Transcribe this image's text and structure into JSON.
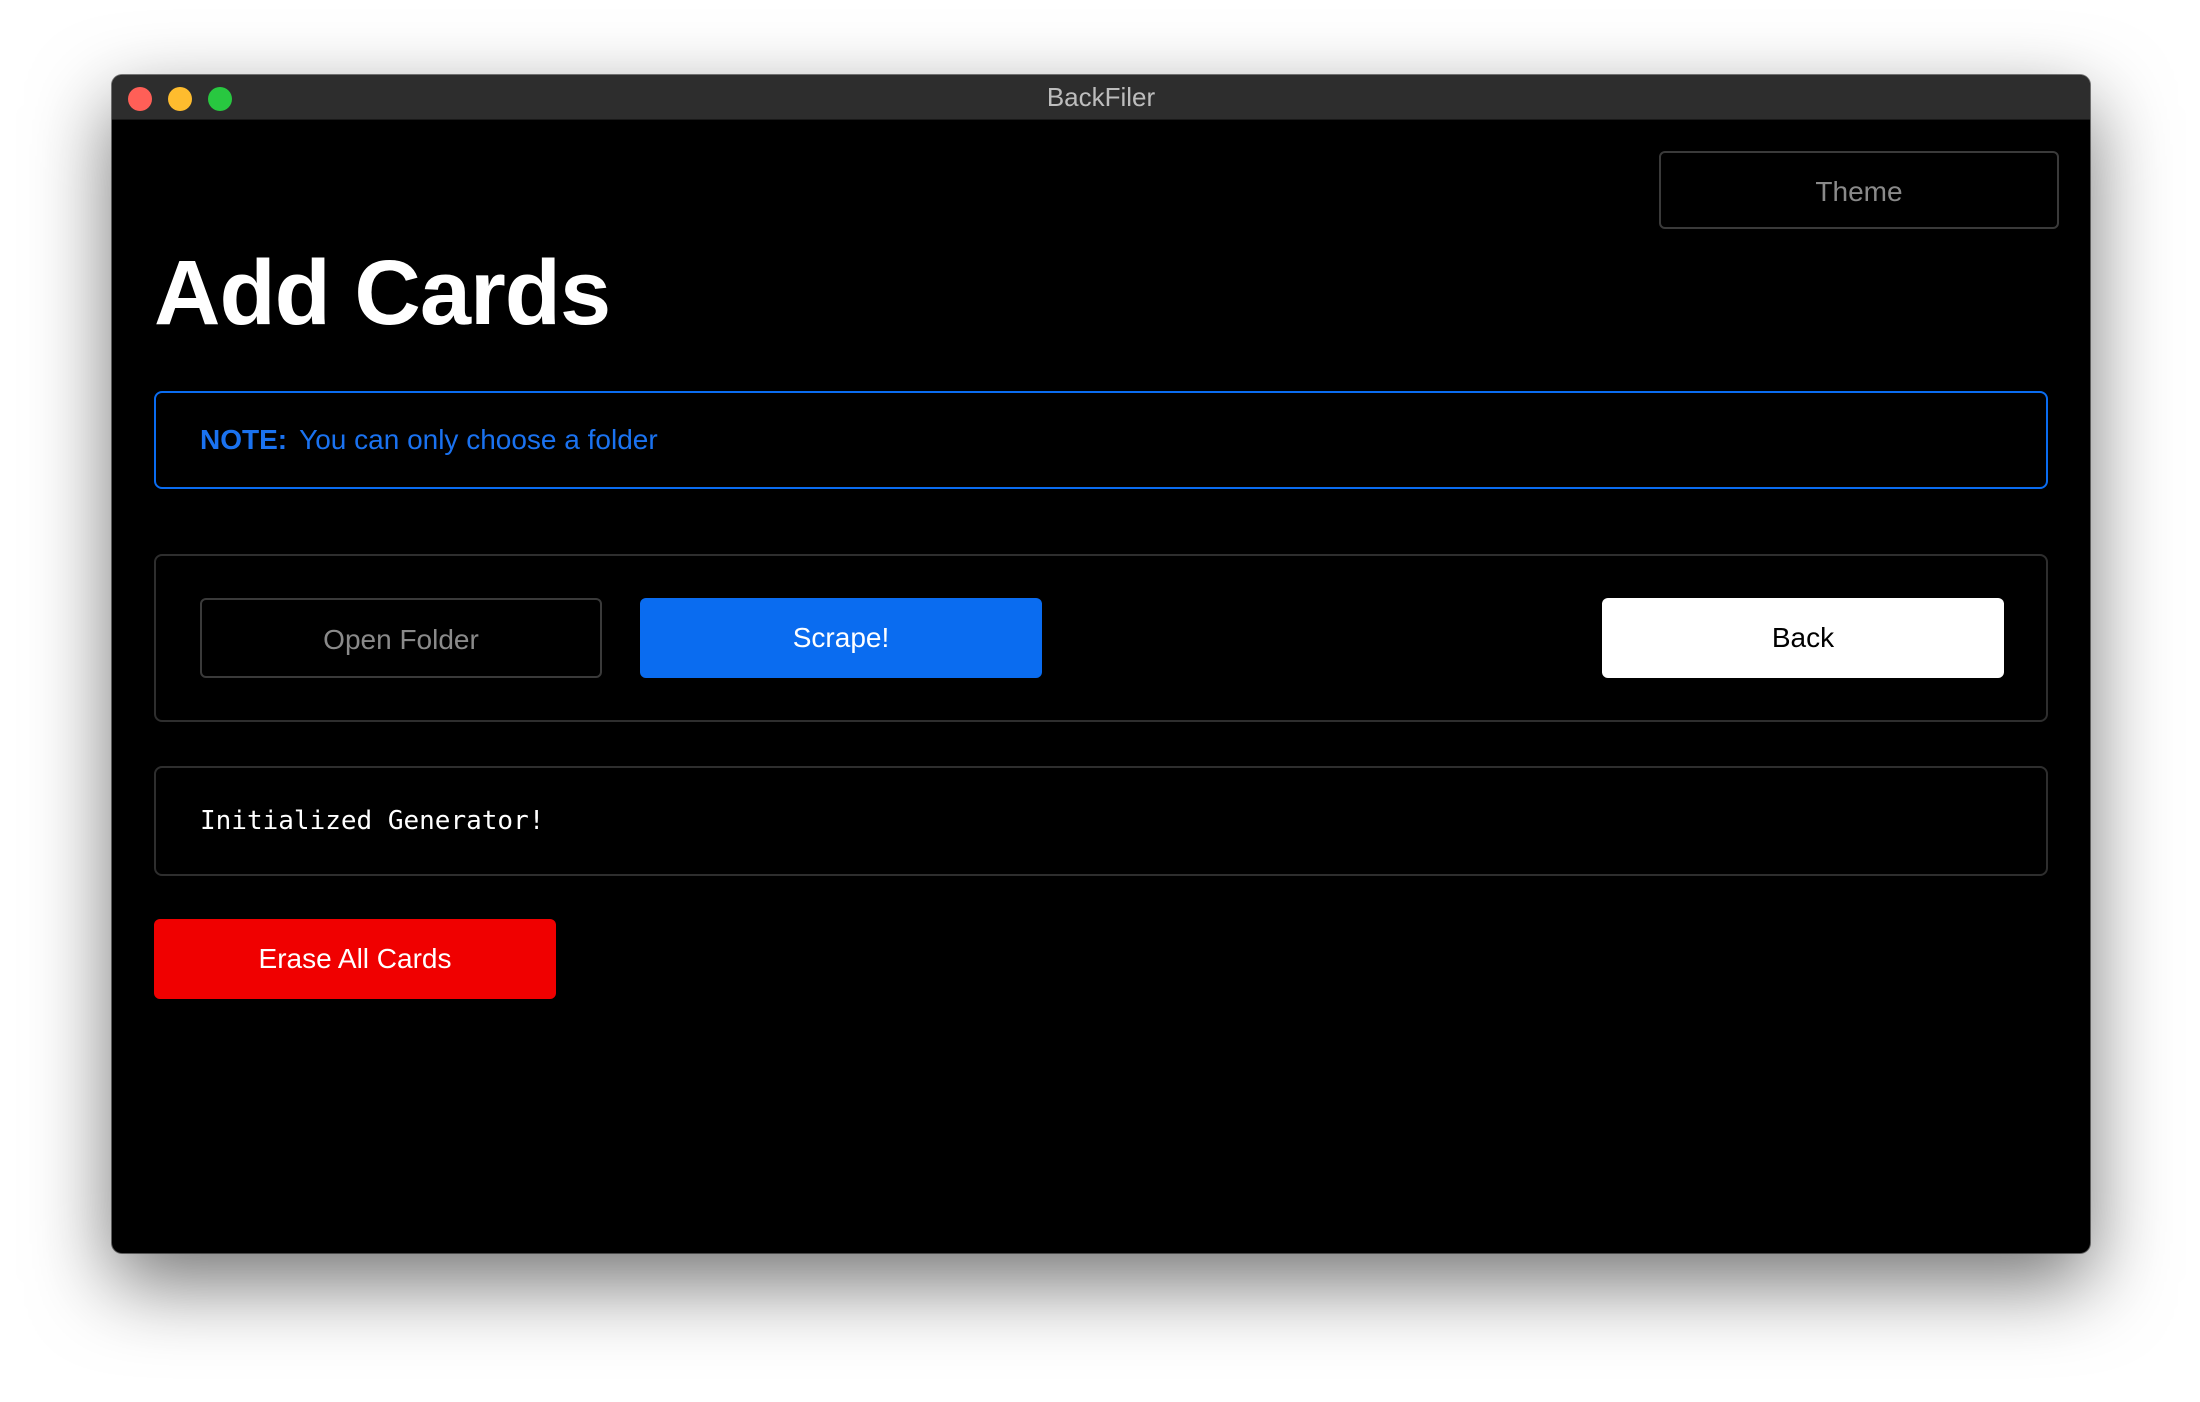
{
  "window": {
    "title": "BackFiler",
    "traffic_lights": {
      "close_color": "#ff5f57",
      "minimize_color": "#febc2e",
      "maximize_color": "#28c840"
    }
  },
  "header": {
    "theme_label": "Theme",
    "page_title": "Add Cards"
  },
  "note": {
    "label": "NOTE:",
    "text": "You can only choose a folder",
    "accent_color": "#0a6cf0"
  },
  "actions": {
    "open_folder_label": "Open Folder",
    "scrape_label": "Scrape!",
    "back_label": "Back"
  },
  "log": {
    "text": "Initialized Generator!"
  },
  "danger": {
    "erase_label": "Erase All Cards",
    "color": "#f00000"
  },
  "colors": {
    "background": "#000000",
    "primary": "#0a6cf0",
    "danger": "#f00000"
  }
}
